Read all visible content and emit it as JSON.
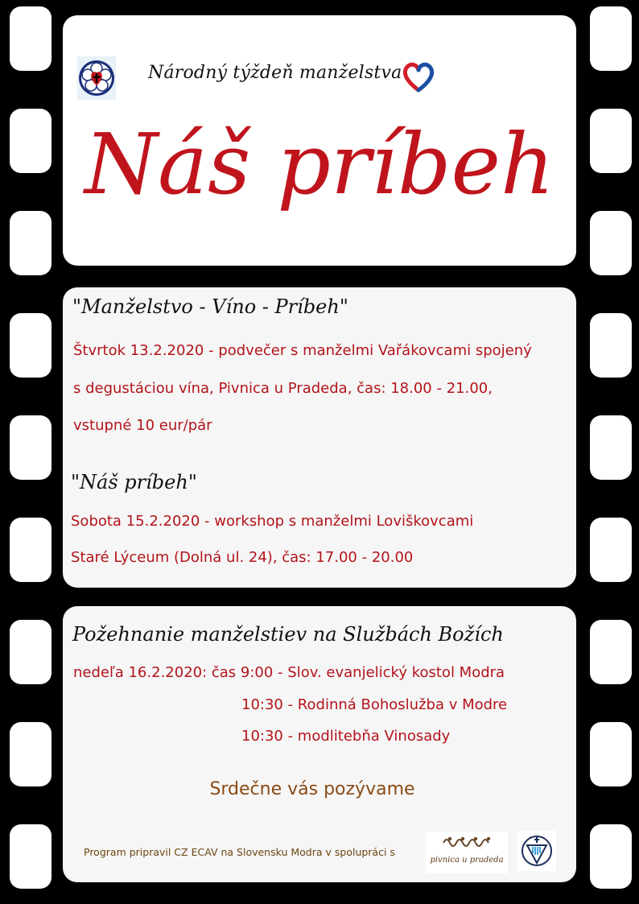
{
  "header": {
    "title": "Národný týždeň manželstva"
  },
  "main_title": "Náš príbeh",
  "section1": {
    "title": "\"Manželstvo - Víno - Príbeh\"",
    "lines": [
      "Štvrtok 13.2.2020 - podvečer s manželmi Vařákovcami spojený",
      "s degustáciou vína, Pivnica u Pradeda, čas: 18.00 - 21.00,",
      "vstupné 10 eur/pár"
    ]
  },
  "section2": {
    "title": "\"Náš príbeh\"",
    "lines": [
      "Sobota 15.2.2020 - workshop s manželmi Loviškovcami",
      "Staré Lýceum (Dolná ul. 24), čas: 17.00 - 20.00"
    ]
  },
  "section3": {
    "title": "Požehnanie manželstiev na Službách Božích",
    "lines": [
      "nedeľa 16.2.2020: čas 9:00 - Slov. evanjelický kostol Modra",
      "10:30 - Rodinná Bohoslužba v Modre",
      "10:30 - modlitebňa Vinosady"
    ]
  },
  "invite": "Srdečne vás pozývame",
  "footer": {
    "note": "Program pripravil CZ ECAV na Slovensku Modra v spolupráci s",
    "pivnica_logo_text": "pivnica u pradeda"
  },
  "colors": {
    "accent_red": "#c0141c",
    "text_red": "#b3141b",
    "brown": "#8a4a14",
    "film_black": "#000000"
  },
  "icons": [
    "luther-rose-icon",
    "heart-logo-icon",
    "pivnica-logo-icon",
    "ecav-logo-icon"
  ]
}
